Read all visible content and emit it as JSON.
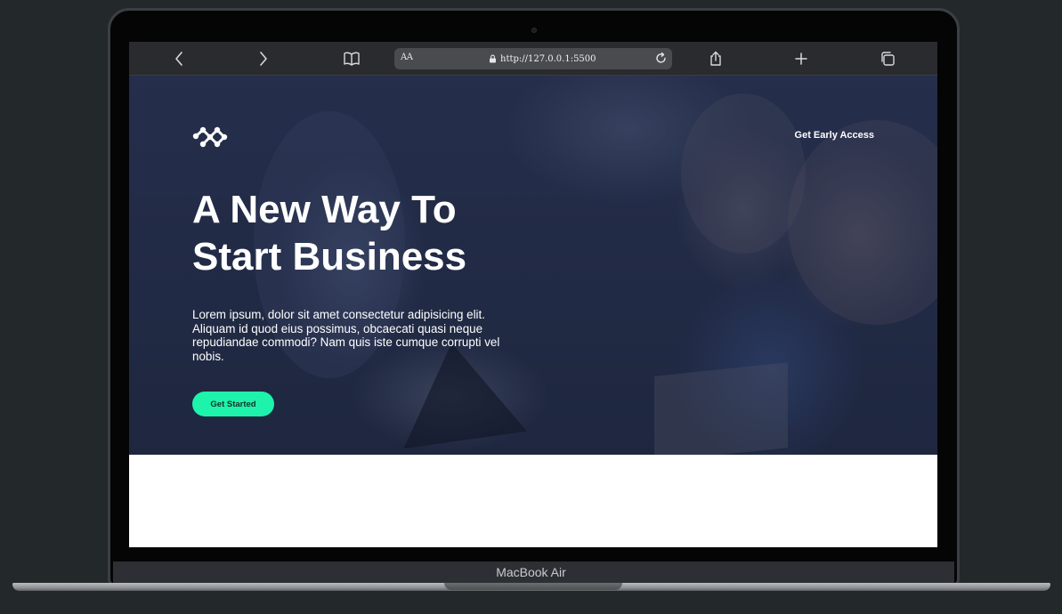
{
  "device": {
    "model_label": "MacBook Air"
  },
  "browser": {
    "reader_label": "AA",
    "url": "http://127.0.0.1:5500",
    "icons": {
      "back": "chevron-left-icon",
      "forward": "chevron-right-icon",
      "bookmarks": "book-icon",
      "secure": "lock-icon",
      "reload": "reload-icon",
      "share": "share-icon",
      "new_tab": "plus-icon",
      "tabs": "tabs-icon"
    }
  },
  "page": {
    "nav": {
      "logo_icon": "network-logo-icon",
      "cta_label": "Get Early Access"
    },
    "hero": {
      "headline": "A New Way To Start Business",
      "lead": "Lorem ipsum, dolor sit amet consectetur adipisicing elit. Aliquam id quod eius possimus, obcaecati quasi neque repudiandae commodi? Nam quis iste cumque corrupti vel nobis.",
      "button_label": "Get Started"
    }
  },
  "colors": {
    "accent": "#1ef3ab",
    "hero_tint": "#1a2240",
    "desktop_background": "#23282b"
  }
}
